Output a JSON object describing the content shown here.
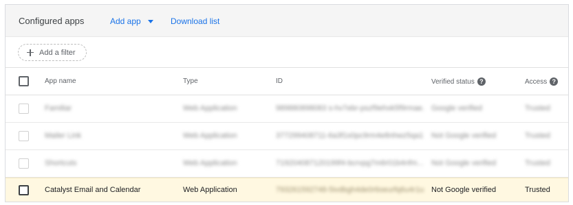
{
  "header": {
    "title": "Configured apps",
    "add_app_label": "Add app",
    "download_label": "Download list"
  },
  "filter": {
    "add_filter_label": "Add a filter"
  },
  "columns": {
    "app_name": "App name",
    "type": "Type",
    "id": "ID",
    "verified_status": "Verified status",
    "access": "Access"
  },
  "rows": [
    {
      "app_name": "Familiar",
      "type": "Web Application",
      "id": "989880898083 s-hv7ebr-pszf9ehxk5f9rmae...",
      "verified_status": "Google verified",
      "access": "Trusted",
      "obscured": true
    },
    {
      "app_name": "Mailer Link",
      "type": "Web Application",
      "id": "377299408711-6a3f1s0pc9rm4e8nhwz5qa1...",
      "verified_status": "Not Google verified",
      "access": "Trusted",
      "obscured": true
    },
    {
      "app_name": "Shortcuts",
      "type": "Web Application",
      "id": "719204087120199f4-bcrvpg7m6r01b4nfm...",
      "verified_status": "Not Google verified",
      "access": "Trusted",
      "obscured": true
    },
    {
      "app_name": "Catalyst Email and Calendar",
      "type": "Web Application",
      "id": "793261592748-5ivdbgh4de0r6oeurfq6u4r1u...",
      "verified_status": "Not Google verified",
      "access": "Trusted",
      "obscured": false,
      "highlighted": true
    }
  ],
  "colors": {
    "link": "#1a73e8",
    "header_bg": "#f5f5f5",
    "highlight_bg": "#fff8e1"
  }
}
